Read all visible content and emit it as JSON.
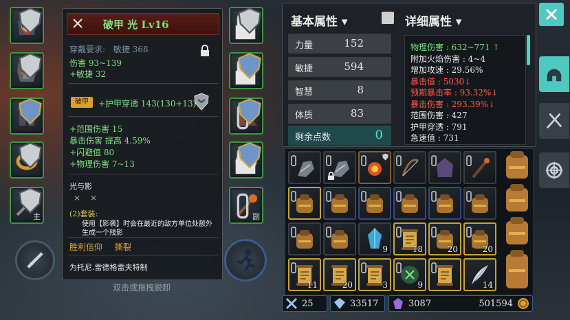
{
  "item_tooltip": {
    "title": "破甲 光 Lv16",
    "requirement_label": "穿戴要求:",
    "requirement_stat": "敏捷 368",
    "damage": "伤害  93~139",
    "agility_bonus": "+敏捷 32",
    "broken_tag": "破甲",
    "armor_pen": "+护甲穿透 143(130+13)",
    "bonus_lines": [
      "+范围伤害 15",
      "暴击伤害 提高 4.59%",
      "+闪避值 80",
      "+物理伤害 7~13"
    ],
    "set_name": "光与影",
    "set_cross_marks": "⨯⨯",
    "set_bonus_label": "(2)套装:",
    "set_bonus_text_1": "使用【影袭】时会在最近的敌方单位处额外",
    "set_bonus_text_2": "生成一个残影",
    "faith_label": "胜利信仰",
    "faith_value": "撕裂",
    "exclusive": "为托尼.雷德格雷夫特制"
  },
  "hint_text": "双击或拖拽脱卸",
  "equip_tags": {
    "left_ring_weapon": "主",
    "right_weapon": "副"
  },
  "stats": {
    "base_title": "基本属性",
    "detail_title": "详细属性",
    "base_rows": [
      {
        "label": "力量",
        "value": "152"
      },
      {
        "label": "敏捷",
        "value": "594"
      },
      {
        "label": "智慧",
        "value": "8"
      },
      {
        "label": "体质",
        "value": "83"
      }
    ],
    "remaining_label": "剩余点数",
    "remaining_value": "0",
    "detail_lines": [
      {
        "text": "物理伤害 : 632~771 ↑",
        "color": "#7ee07f"
      },
      {
        "text": "附加火焰伤害 : 4~4",
        "color": "#e6e6e6"
      },
      {
        "text": "增加攻速 : 29.56%",
        "color": "#e6e6e6"
      },
      {
        "text": "暴击值 : 5030↓",
        "color": "#ff5a4e"
      },
      {
        "text": "预期暴击率 : 93.32%↓",
        "color": "#ff5a4e"
      },
      {
        "text": "暴击伤害 : 293.39%↓",
        "color": "#ff5a4e"
      },
      {
        "text": "范围伤害 : 427",
        "color": "#e6e6e6"
      },
      {
        "text": "护甲穿透 : 791",
        "color": "#e6e6e6"
      },
      {
        "text": "急速值 : 731",
        "color": "#e6e6e6"
      }
    ]
  },
  "inventory": {
    "rows": [
      [
        {
          "icon": "gauntlet-icon",
          "count": "",
          "border": "#3b3f44",
          "clip": true,
          "lock": false,
          "shield": false
        },
        {
          "icon": "gauntlet-icon",
          "count": "",
          "border": "#3b3f44",
          "clip": true,
          "lock": true,
          "shield": false
        },
        {
          "icon": "fire-orb-icon",
          "count": "",
          "border": "#8b5a2b",
          "clip": true,
          "lock": false,
          "shield": true
        },
        {
          "icon": "bow-icon",
          "count": "",
          "border": "#3b3f44",
          "clip": true,
          "lock": false,
          "shield": false
        },
        {
          "icon": "hood-icon",
          "count": "",
          "border": "#3b3f44",
          "clip": true,
          "lock": false,
          "shield": false
        },
        {
          "icon": "staff-icon",
          "count": "",
          "border": "#3b3f44",
          "clip": true,
          "lock": false,
          "shield": false
        }
      ],
      [
        {
          "icon": "backpack-icon",
          "count": "",
          "border": "#c7a33a",
          "clip": true,
          "lock": false,
          "shield": false
        },
        {
          "icon": "backpack-icon",
          "count": "",
          "border": "#3a4780",
          "clip": true,
          "lock": false,
          "shield": false
        },
        {
          "icon": "backpack-icon",
          "count": "",
          "border": "#3a4780",
          "clip": true,
          "lock": false,
          "shield": false
        },
        {
          "icon": "backpack-icon",
          "count": "",
          "border": "#3a4780",
          "clip": true,
          "lock": false,
          "shield": false
        },
        {
          "icon": "backpack-icon",
          "count": "",
          "border": "#3a4780",
          "clip": true,
          "lock": false,
          "shield": false
        },
        {
          "icon": "backpack-icon",
          "count": "",
          "border": "#3b3f44",
          "clip": true,
          "lock": false,
          "shield": false
        }
      ],
      [
        {
          "icon": "backpack-icon",
          "count": "",
          "border": "#3b3f44",
          "clip": true,
          "lock": false,
          "shield": false
        },
        {
          "icon": "backpack-icon",
          "count": "",
          "border": "#3b3f44",
          "clip": true,
          "lock": false,
          "shield": false
        },
        {
          "icon": "crystal-icon",
          "count": "9",
          "border": "#3b3f44",
          "clip": false,
          "lock": false,
          "shield": false
        },
        {
          "icon": "scroll-icon",
          "count": "18",
          "border": "#c7a33a",
          "clip": true,
          "lock": false,
          "shield": false
        },
        {
          "icon": "backpack-icon",
          "count": "20",
          "border": "#c7a33a",
          "clip": true,
          "lock": false,
          "shield": false
        },
        {
          "icon": "backpack-icon",
          "count": "20",
          "border": "#c7a33a",
          "clip": true,
          "lock": false,
          "shield": false
        }
      ],
      [
        {
          "icon": "scroll-icon",
          "count": "11",
          "border": "#c7a33a",
          "clip": true,
          "lock": false,
          "shield": false
        },
        {
          "icon": "scroll-icon",
          "count": "20",
          "border": "#c7a33a",
          "clip": false,
          "lock": false,
          "shield": false
        },
        {
          "icon": "scroll-icon",
          "count": "3",
          "border": "#c7a33a",
          "clip": true,
          "lock": false,
          "shield": false
        },
        {
          "icon": "rune-icon",
          "count": "9",
          "border": "#c7a33a",
          "clip": true,
          "lock": false,
          "shield": false
        },
        {
          "icon": "scroll-icon",
          "count": "",
          "border": "#c7a33a",
          "clip": true,
          "lock": false,
          "shield": false
        },
        {
          "icon": "feather-icon",
          "count": "14",
          "border": "#c7a33a",
          "clip": false,
          "lock": false,
          "shield": false
        }
      ]
    ]
  },
  "currency": {
    "swords": "25",
    "gems": "33517",
    "crystal": "3087",
    "gold": "501594"
  },
  "colors": {
    "equipped_border": "#3a9a3c",
    "accent_teal": "#4dc9c0",
    "green_text": "#7ee07f",
    "red_text": "#ff5a4e"
  }
}
